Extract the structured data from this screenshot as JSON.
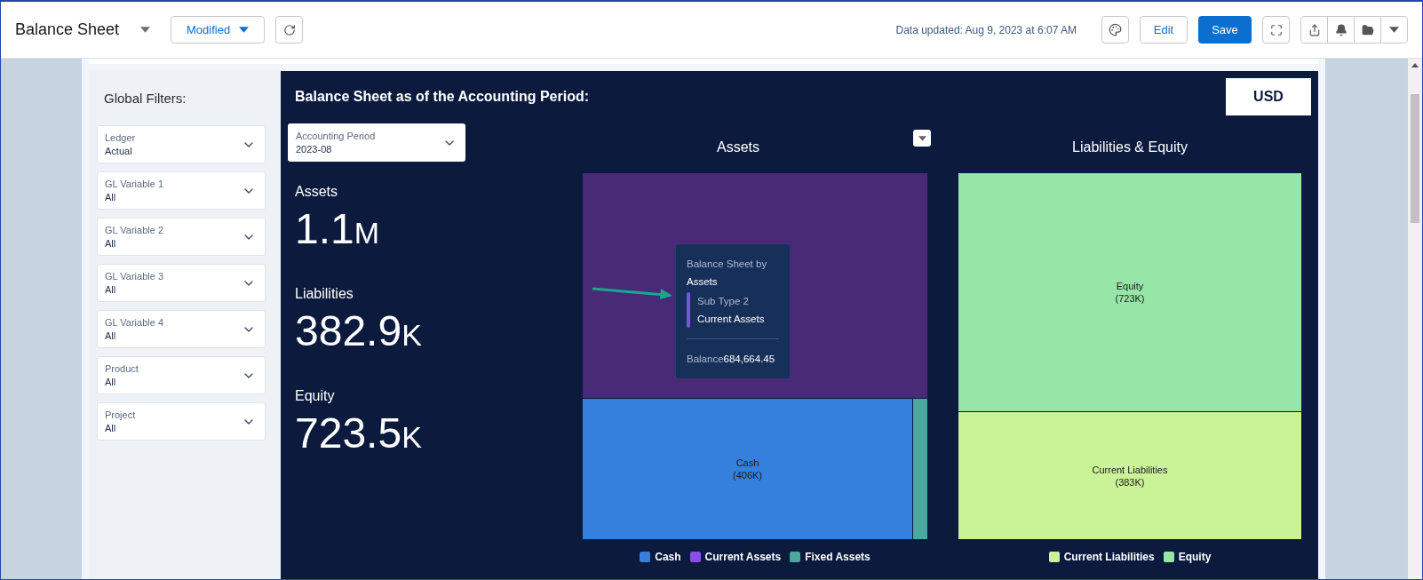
{
  "header": {
    "title": "Balance Sheet",
    "view_menu": "Modified",
    "data_updated": "Data updated: Aug 9, 2023 at 6:07 AM",
    "edit": "Edit",
    "save": "Save"
  },
  "filters": {
    "title": "Global Filters:",
    "items": [
      {
        "label": "Ledger",
        "value": "Actual"
      },
      {
        "label": "GL Variable 1",
        "value": "All"
      },
      {
        "label": "GL Variable 2",
        "value": "All"
      },
      {
        "label": "GL Variable 3",
        "value": "All"
      },
      {
        "label": "GL Variable 4",
        "value": "All"
      },
      {
        "label": "Product",
        "value": "All"
      },
      {
        "label": "Project",
        "value": "All"
      }
    ]
  },
  "dashboard": {
    "title": "Balance Sheet as of the Accounting Period:",
    "currency": "USD",
    "period": {
      "label": "Accounting Period",
      "value": "2023-08"
    },
    "kpis": [
      {
        "label": "Assets",
        "number": "1.1",
        "unit": "M"
      },
      {
        "label": "Liabilities",
        "number": "382.9",
        "unit": "K"
      },
      {
        "label": "Equity",
        "number": "723.5",
        "unit": "K"
      }
    ],
    "assets_chart": {
      "title": "Assets",
      "tiles": [
        {
          "color": "#482a77"
        },
        {
          "label": "Cash",
          "value": "(406K)",
          "color": "#3580dd"
        },
        {
          "color": "#4aa8a0"
        }
      ],
      "legend": [
        {
          "label": "Cash",
          "color": "#3580dd"
        },
        {
          "label": "Current Assets",
          "color": "#8a4fe8"
        },
        {
          "label": "Fixed Assets",
          "color": "#4aa8a0"
        }
      ],
      "tooltip": {
        "title": "Balance Sheet by",
        "group": "Assets",
        "sub_label": "Sub Type 2",
        "sub_value": "Current Assets",
        "color": "#7e4fe8",
        "balance_label": "Balance",
        "balance_value": "684,664.45"
      }
    },
    "liabilities_chart": {
      "title": "Liabilities & Equity",
      "tiles": [
        {
          "label": "Equity",
          "value": "(723K)",
          "color": "#96e6a8"
        },
        {
          "label": "Current Liabilities",
          "value": "(383K)",
          "color": "#caf297"
        }
      ],
      "legend": [
        {
          "label": "Current Liabilities",
          "color": "#caf297"
        },
        {
          "label": "Equity",
          "color": "#96e6a8"
        }
      ]
    }
  }
}
